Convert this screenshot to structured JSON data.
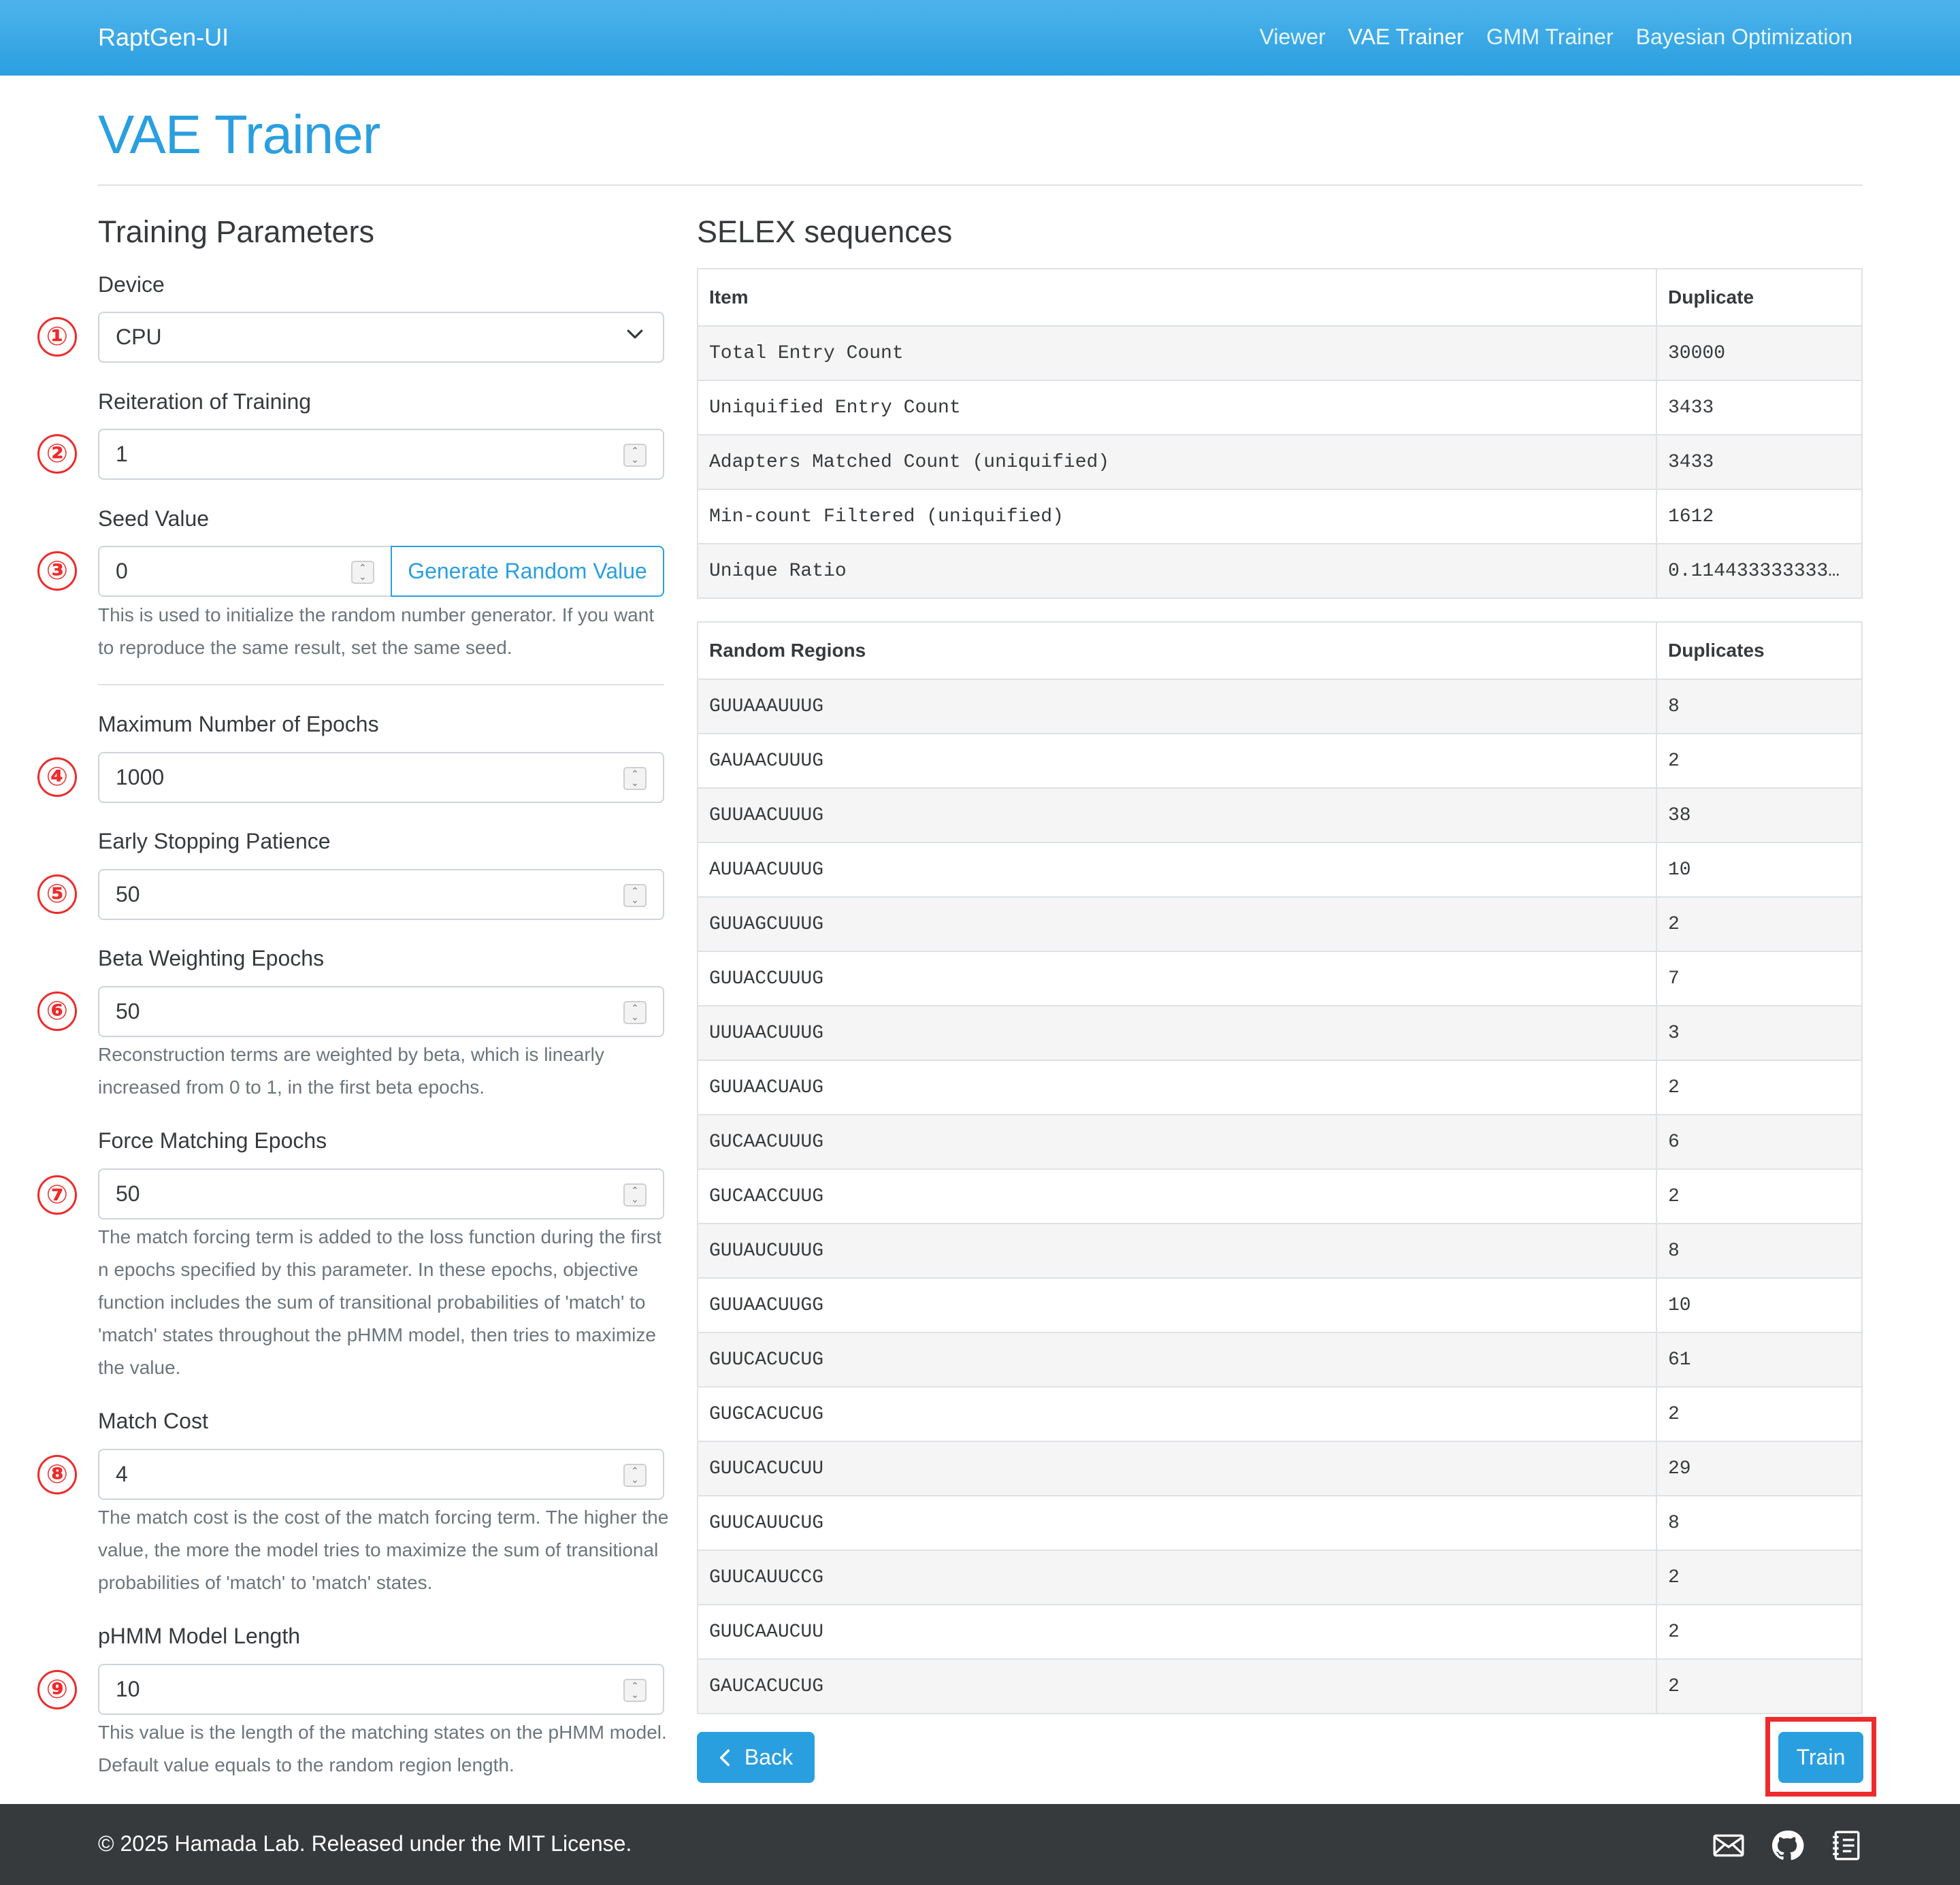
{
  "navbar": {
    "brand": "RaptGen-UI",
    "links": [
      {
        "label": "Viewer"
      },
      {
        "label": "VAE Trainer"
      },
      {
        "label": "GMM Trainer"
      },
      {
        "label": "Bayesian Optimization"
      }
    ]
  },
  "page": {
    "title": "VAE Trainer"
  },
  "training": {
    "title": "Training Parameters",
    "device": {
      "label": "Device",
      "value": "CPU",
      "marker": "①"
    },
    "reiteration": {
      "label": "Reiteration of Training",
      "value": "1",
      "marker": "②"
    },
    "seed": {
      "label": "Seed Value",
      "value": "0",
      "marker": "③",
      "generate_label": "Generate Random Value",
      "help": "This is used to initialize the random number generator. If you want to reproduce the same result, set the same seed."
    },
    "max_epochs": {
      "label": "Maximum Number of Epochs",
      "value": "1000",
      "marker": "④"
    },
    "early_stopping": {
      "label": "Early Stopping Patience",
      "value": "50",
      "marker": "⑤"
    },
    "beta_epochs": {
      "label": "Beta Weighting Epochs",
      "value": "50",
      "marker": "⑥",
      "help": "Reconstruction terms are weighted by beta, which is linearly increased from 0 to 1, in the first beta epochs."
    },
    "force_matching": {
      "label": "Force Matching Epochs",
      "value": "50",
      "marker": "⑦",
      "help": "The match forcing term is added to the loss function during the first n epochs specified by this parameter. In these epochs, objective function includes the sum of transitional probabilities of 'match' to 'match' states throughout the pHMM model, then tries to maximize the value."
    },
    "match_cost": {
      "label": "Match Cost",
      "value": "4",
      "marker": "⑧",
      "help": "The match cost is the cost of the match forcing term. The higher the value, the more the model tries to maximize the sum of transitional probabilities of 'match' to 'match' states."
    },
    "phmm_length": {
      "label": "pHMM Model Length",
      "value": "10",
      "marker": "⑨",
      "help": "This value is the length of the matching states on the pHMM model. Default value equals to the random region length."
    }
  },
  "selex": {
    "title": "SELEX sequences",
    "summary": {
      "headers": [
        "Item",
        "Duplicate"
      ],
      "rows": [
        [
          "Total Entry Count",
          "30000"
        ],
        [
          "Uniquified Entry Count",
          "3433"
        ],
        [
          "Adapters Matched Count (uniquified)",
          "3433"
        ],
        [
          "Min-count Filtered (uniquified)",
          "1612"
        ],
        [
          "Unique Ratio",
          "0.114433333333…"
        ]
      ]
    },
    "regions": {
      "headers": [
        "Random Regions",
        "Duplicates"
      ],
      "rows": [
        [
          "GUUAAAUUUG",
          "8"
        ],
        [
          "GAUAACUUUG",
          "2"
        ],
        [
          "GUUAACUUUG",
          "38"
        ],
        [
          "AUUAACUUUG",
          "10"
        ],
        [
          "GUUAGCUUUG",
          "2"
        ],
        [
          "GUUACCUUUG",
          "7"
        ],
        [
          "UUUAACUUUG",
          "3"
        ],
        [
          "GUUAACUAUG",
          "2"
        ],
        [
          "GUCAACUUUG",
          "6"
        ],
        [
          "GUCAACCUUG",
          "2"
        ],
        [
          "GUUAUCUUUG",
          "8"
        ],
        [
          "GUUAACUUGG",
          "10"
        ],
        [
          "GUUCACUCUG",
          "61"
        ],
        [
          "GUGCACUCUG",
          "2"
        ],
        [
          "GUUCACUCUU",
          "29"
        ],
        [
          "GUUCAUUCUG",
          "8"
        ],
        [
          "GUUCAUUCCG",
          "2"
        ],
        [
          "GUUCAAUCUU",
          "2"
        ],
        [
          "GAUCACUCUG",
          "2"
        ]
      ]
    }
  },
  "actions": {
    "back_label": "Back",
    "train_label": "Train"
  },
  "footer": {
    "copyright": "© 2025 Hamada Lab. Released under the MIT License.",
    "icons": [
      "mail-icon",
      "github-icon",
      "document-icon"
    ]
  },
  "colors": {
    "primary": "#2a9fe0",
    "marker": "#ee2b2b",
    "footer": "#373a3c"
  }
}
